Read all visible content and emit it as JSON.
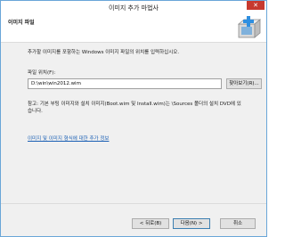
{
  "window": {
    "title": "이미지 추가 마법사",
    "close_glyph": "✕"
  },
  "header": {
    "page_title": "이미지 파일",
    "icon": "wizard-image-icon"
  },
  "content": {
    "description": "추가할 이미지를 포함하는 Windows 이미지 파일의 위치를 입력하십시오.",
    "file_location_label": "파일 위치(F):",
    "file_location_value": "D:\\win\\win2012.wim",
    "browse_label": "찾아보기(R)...",
    "note": "참고: 기본 부팅 이미지와 설치 이미지(Boot.wim 및 Install.wim)는 \\Sources 폴더의 설치 DVD에 있습니다.",
    "link": "이미지 및 이미지 형식에 대한 추가 정보"
  },
  "footer": {
    "back_label": "< 뒤로(B)",
    "next_label": "다음(N) >",
    "cancel_label": "취소"
  },
  "colors": {
    "close": "#c7392f",
    "link": "#1a5fb4",
    "border": "#6aa6d8"
  }
}
